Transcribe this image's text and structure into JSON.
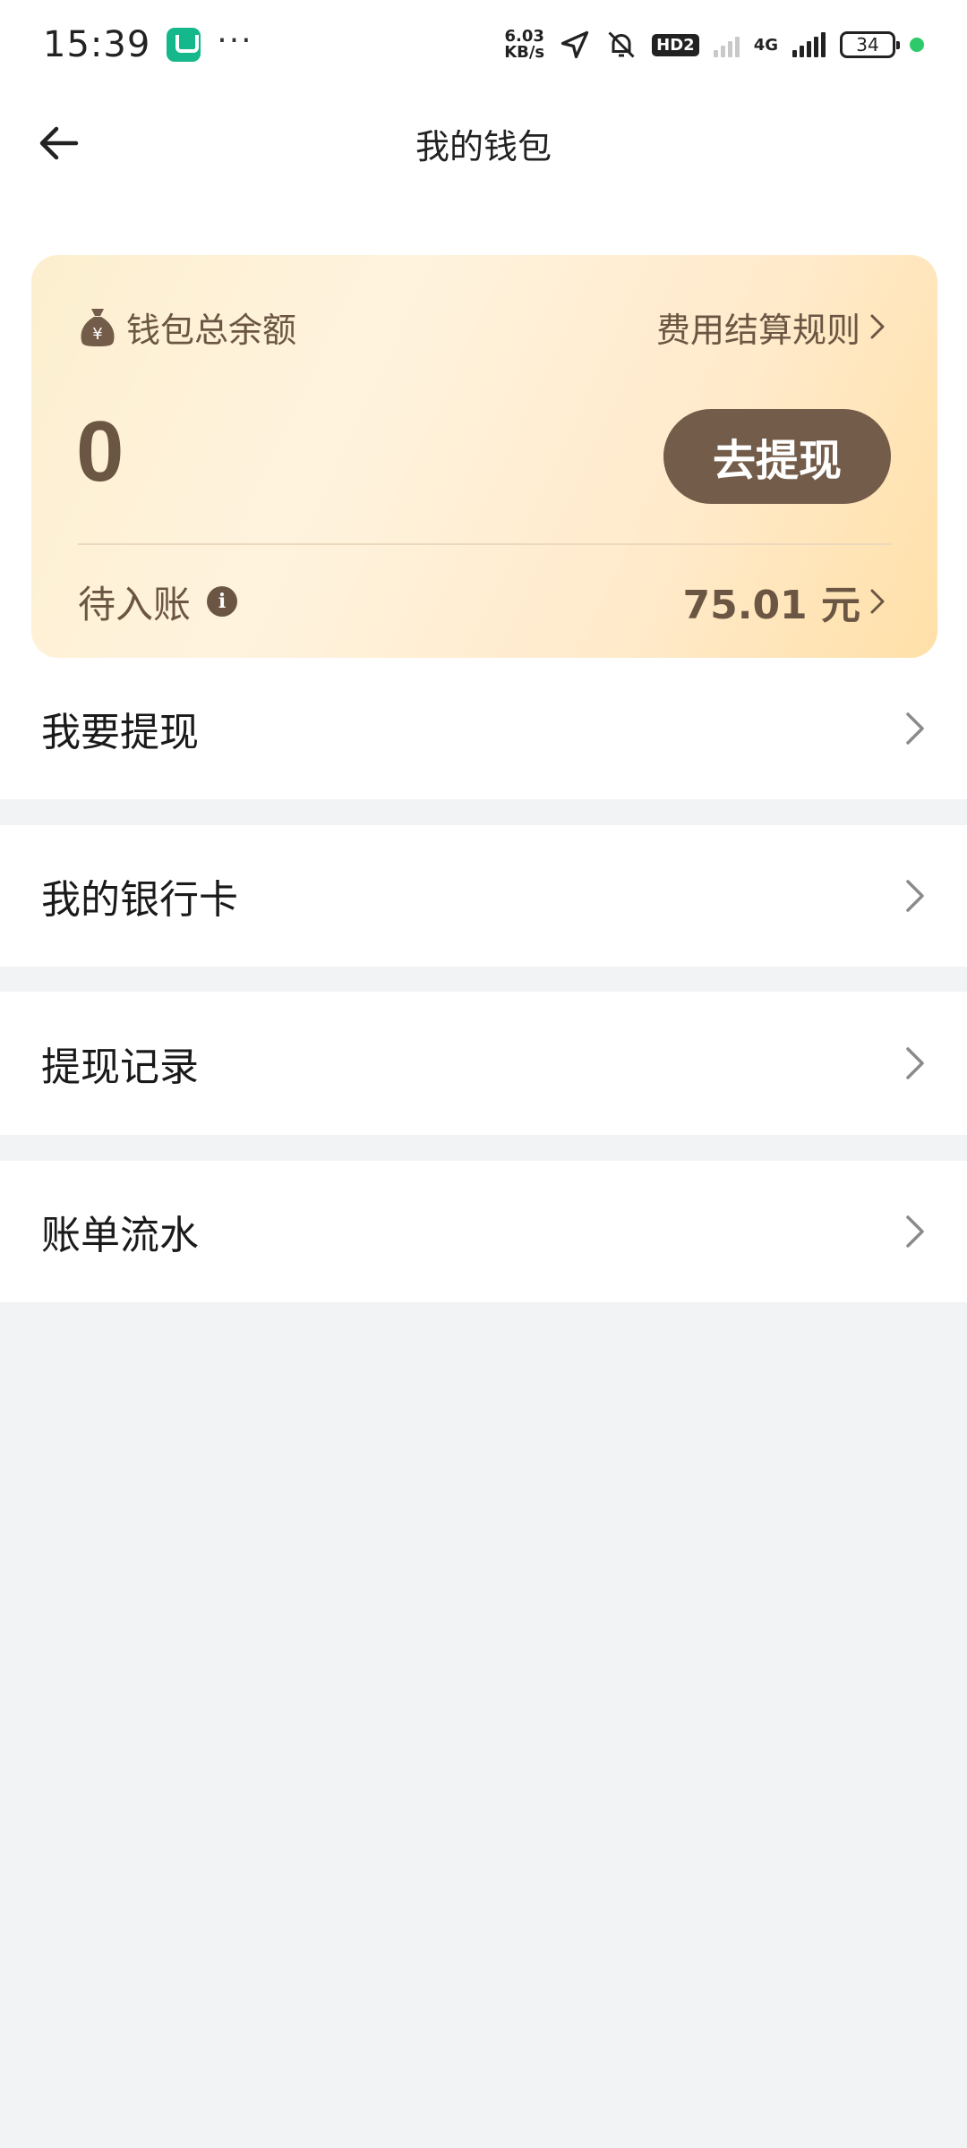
{
  "status_bar": {
    "time": "15:39",
    "more": "···",
    "net_speed_value": "6.03",
    "net_speed_unit": "KB/s",
    "hd_label": "HD2",
    "net_type": "4G",
    "battery": "34"
  },
  "nav": {
    "title": "我的钱包"
  },
  "wallet_card": {
    "label": "钱包总余额",
    "rules_label": "费用结算规则",
    "balance": "0",
    "withdraw_button": "去提现",
    "pending_label": "待入账",
    "pending_amount": "75.01 元"
  },
  "menu": {
    "items": [
      {
        "label": "我要提现"
      },
      {
        "label": "我的银行卡"
      },
      {
        "label": "提现记录"
      },
      {
        "label": "账单流水"
      }
    ]
  },
  "colors": {
    "accent_brown": "#735c4a",
    "card_gold": "#ffe0a8",
    "background": "#f2f3f5"
  }
}
